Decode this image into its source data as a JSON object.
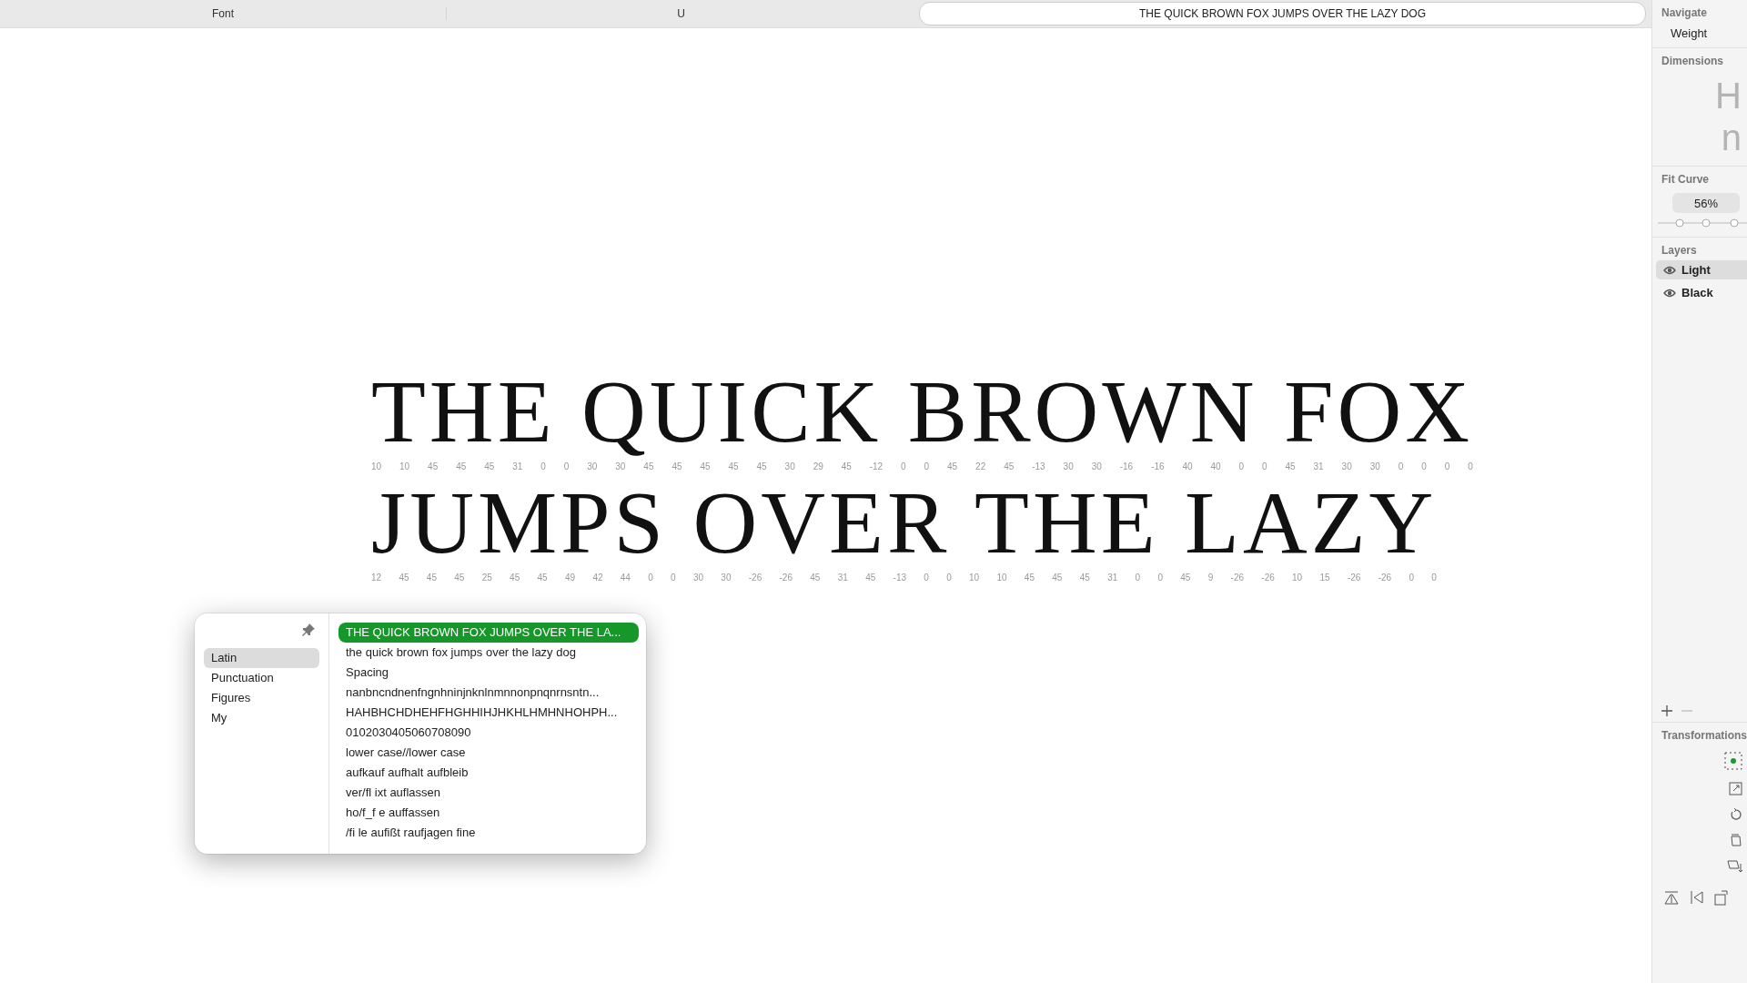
{
  "toolbar": {
    "font_label": "Font",
    "layer_label": "U",
    "sample_text": "THE QUICK BROWN FOX JUMPS OVER THE LAZY DOG"
  },
  "canvas": {
    "lines": [
      {
        "text": "THE QUICK BROWN FOX",
        "metrics": [
          "10",
          "10",
          "45",
          "45",
          "45",
          "31",
          "0",
          "0",
          "30",
          "30",
          "45",
          "45",
          "45",
          "45",
          "45",
          "30",
          "29",
          "45",
          "-12",
          "0",
          "0",
          "45",
          "22",
          "45",
          "-13",
          "30",
          "30",
          "-16",
          "-16",
          "40",
          "40",
          "0",
          "0",
          "45",
          "31",
          "30",
          "30",
          "0",
          "0",
          "0",
          "0"
        ]
      },
      {
        "text": "JUMPS OVER THE LAZY",
        "metrics": [
          "12",
          "45",
          "45",
          "45",
          "25",
          "45",
          "45",
          "49",
          "42",
          "44",
          "0",
          "0",
          "30",
          "30",
          "-26",
          "-26",
          "45",
          "31",
          "45",
          "-13",
          "0",
          "0",
          "10",
          "10",
          "45",
          "45",
          "45",
          "31",
          "0",
          "0",
          "45",
          "9",
          "-26",
          "-26",
          "10",
          "15",
          "-26",
          "-26",
          "0",
          "0"
        ]
      }
    ]
  },
  "sample_popup": {
    "categories": [
      {
        "label": "Latin",
        "selected": true
      },
      {
        "label": "Punctuation",
        "selected": false
      },
      {
        "label": "Figures",
        "selected": false
      },
      {
        "label": "My",
        "selected": false
      }
    ],
    "samples": [
      {
        "label": "THE QUICK BROWN FOX JUMPS OVER THE LA...",
        "selected": true
      },
      {
        "label": "the quick brown fox jumps over the lazy dog",
        "selected": false
      },
      {
        "label": "Spacing",
        "selected": false
      },
      {
        "label": "nanbncndnenfngnhninjnknlnmnnonpnqnrnsntn...",
        "selected": false
      },
      {
        "label": "HAHBHCHDHEHFHGHHIHJHKHLHMHNHOHPH...",
        "selected": false
      },
      {
        "label": "0102030405060708090",
        "selected": false
      },
      {
        "label": "lower case//lower case",
        "selected": false
      },
      {
        "label": "aufkauf aufhalt aufbleib",
        "selected": false
      },
      {
        "label": "ver/fl ixt auflassen",
        "selected": false
      },
      {
        "label": "ho/f_f e auffassen",
        "selected": false
      },
      {
        "label": "/fi le aufißt raufjagen fine",
        "selected": false
      }
    ]
  },
  "sidebar": {
    "navigate": {
      "title": "Navigate",
      "item": "Weight"
    },
    "dimensions": {
      "title": "Dimensions",
      "previews": [
        "H",
        "n"
      ]
    },
    "fit_curve": {
      "title": "Fit Curve",
      "value": "56%"
    },
    "layers": {
      "title": "Layers",
      "items": [
        {
          "name": "Light",
          "selected": true,
          "visible": true
        },
        {
          "name": "Black",
          "selected": false,
          "visible": true
        }
      ]
    },
    "transformations": {
      "title": "Transformations"
    }
  }
}
